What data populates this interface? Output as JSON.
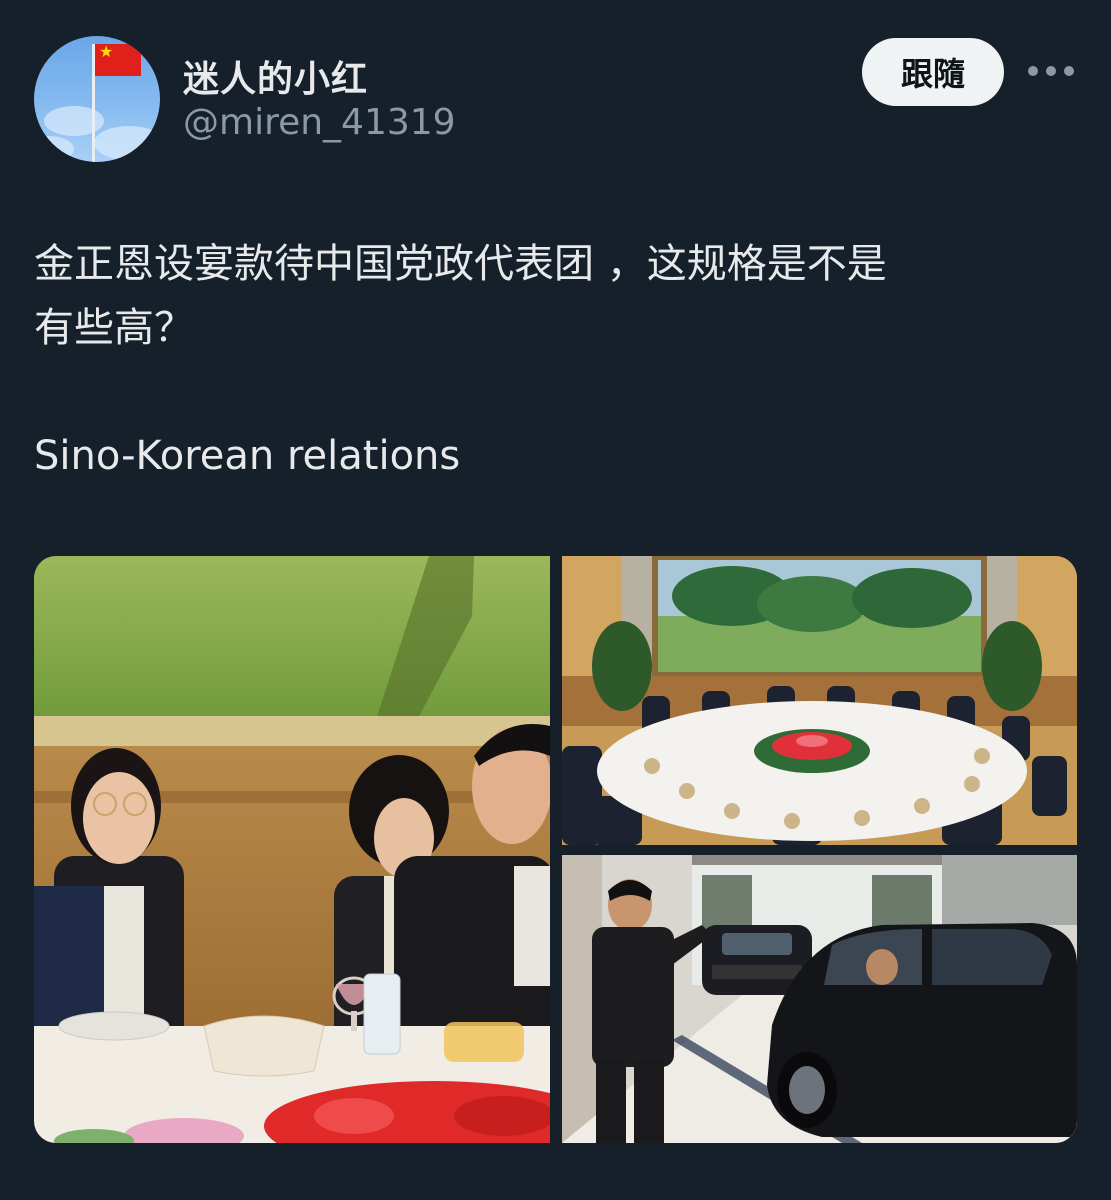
{
  "user": {
    "display_name": "迷人的小红",
    "handle": "@miren_41319",
    "avatar_icon": "chinese-flag-avatar"
  },
  "actions": {
    "follow_label": "跟隨",
    "more_icon": "ellipsis-icon"
  },
  "post": {
    "text_line1": "金正恩设宴款待中国党政代表团 ，这规格是不是",
    "text_line2": "有些高？",
    "text_line3": "Sino-Korean relations"
  },
  "colors": {
    "background": "#15202b",
    "text_primary": "#e7e9ea",
    "text_secondary": "#8b98a5",
    "follow_bg": "#eff3f4"
  }
}
